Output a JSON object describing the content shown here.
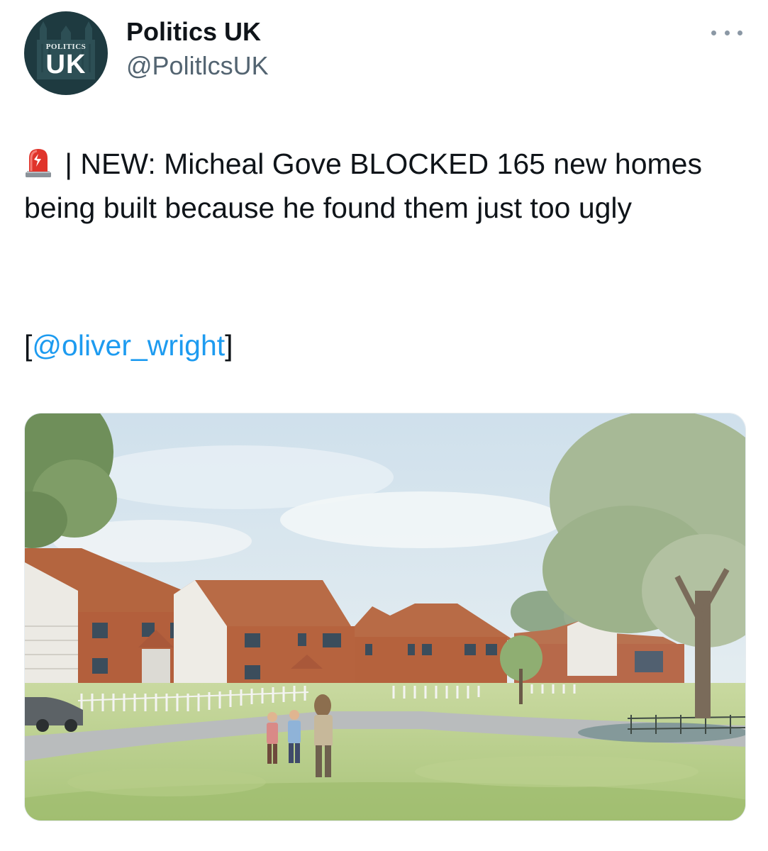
{
  "account": {
    "name": "Politics UK",
    "handle": "@PolitlcsUK",
    "avatar_text_small": "POLITICS",
    "avatar_text_big": "UK"
  },
  "more_icon": "more-dots-icon",
  "tweet": {
    "emoji_icon": "police-siren-icon",
    "text": " | NEW: Micheal Gove BLOCKED 165 new homes being built because he found them just too ugly",
    "mention_open": "[",
    "mention": "@oliver_wright",
    "mention_close": "]"
  },
  "colors": {
    "link": "#1d9bf0",
    "secondary_text": "#536471",
    "avatar_bg": "#1e3a40"
  }
}
